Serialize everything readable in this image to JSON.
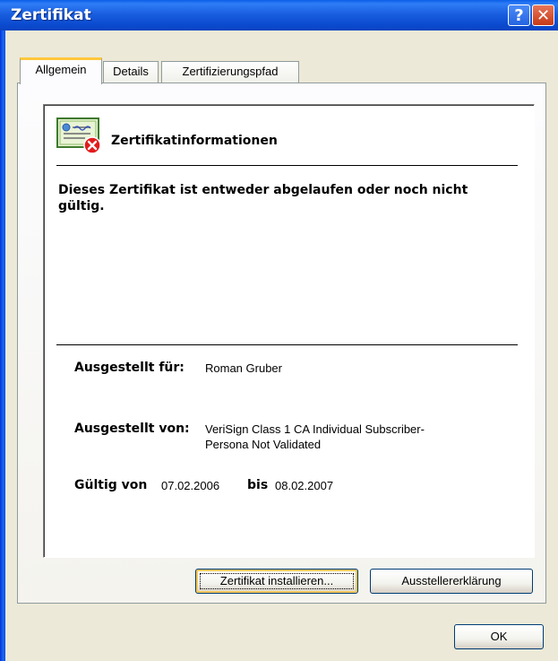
{
  "window": {
    "title": "Zertifikat",
    "help_glyph": "?",
    "close_glyph": "✕"
  },
  "tabs": [
    {
      "label": "Allgemein",
      "active": true
    },
    {
      "label": "Details",
      "active": false
    },
    {
      "label": "Zertifizierungspfad",
      "active": false
    }
  ],
  "cert": {
    "icon": "certificate-error-icon",
    "title": "Zertifikatinformationen",
    "warning": "Dieses Zertifikat ist entweder abgelaufen oder noch nicht gültig.",
    "issued_to_label": "Ausgestellt für:",
    "issued_to_value": "Roman Gruber",
    "issued_by_label": "Ausgestellt von:",
    "issued_by_value_line1": "VeriSign Class 1 CA Individual Subscriber-",
    "issued_by_value_line2": "Persona Not Validated",
    "valid_from_label": "Gültig von",
    "valid_from_value": "07.02.2006",
    "valid_to_label": "bis",
    "valid_to_value": "08.02.2007"
  },
  "buttons": {
    "install": "Zertifikat installieren...",
    "issuer_statement": "Ausstellererklärung",
    "ok": "OK"
  },
  "colors": {
    "titlebar": "#0b4bd0",
    "dialog_bg": "#ece9d8",
    "tab_highlight": "#ffc83c",
    "close_red": "#c63a16",
    "error_red": "#e21b1b"
  }
}
